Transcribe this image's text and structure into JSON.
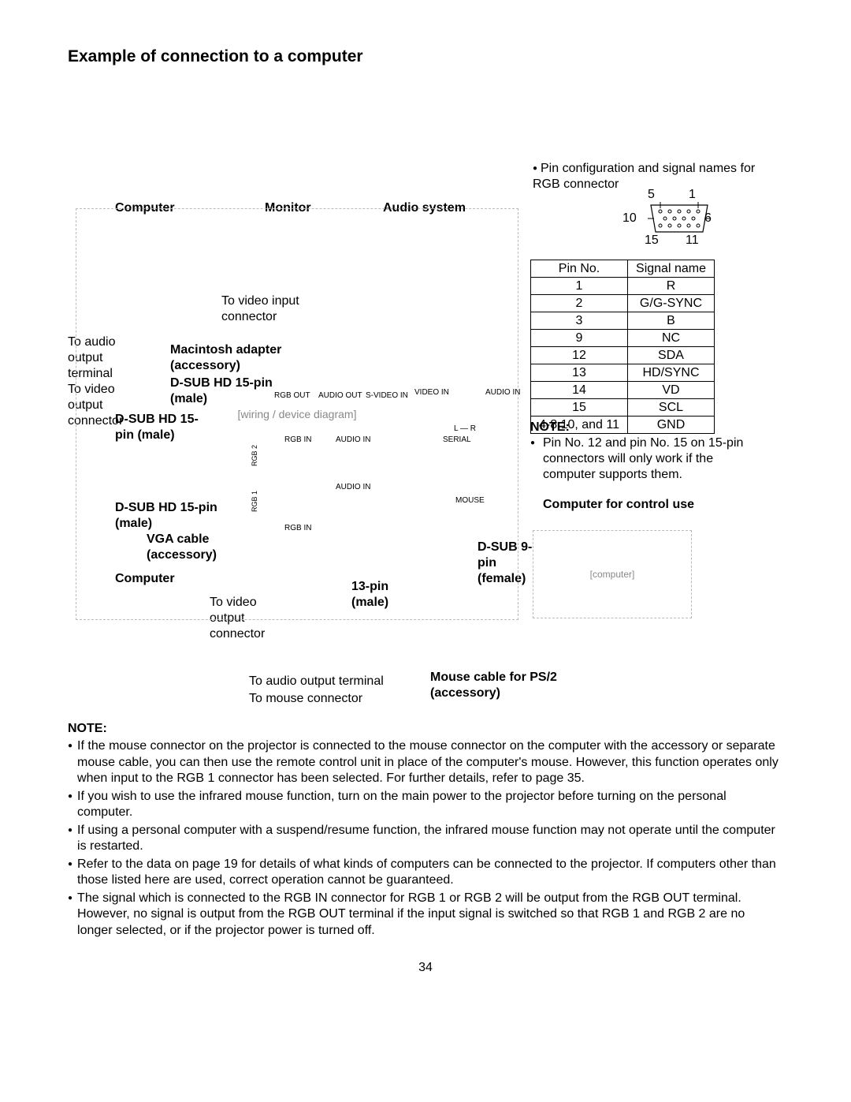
{
  "title": "Example of connection to a computer",
  "pin_header": "Pin configuration and signal names for RGB connector",
  "connector_numbers": {
    "tl": "5",
    "tr": "1",
    "ml": "10",
    "mr": "6",
    "bl": "15",
    "br": "11"
  },
  "labels": {
    "computer": "Computer",
    "monitor": "Monitor",
    "audio_system": "Audio system",
    "to_audio_output_terminal_left": "To audio output terminal",
    "to_video_output_connector_left": "To video output connector",
    "to_video_input_connector": "To video input connector",
    "mac_adapter": "Macintosh adapter (accessory)",
    "dsub_hd15_male_top": "D-SUB HD 15-pin (male)",
    "dsub_hd15_male_left": "D-SUB HD 15-pin (male)",
    "dsub_hd15_male_lower": "D-SUB HD 15-pin (male)",
    "vga_cable": "VGA cable (accessory)",
    "computer2": "Computer",
    "to_video_output_connector2": "To video output connector",
    "to_audio_output_terminal2": "To audio output terminal",
    "to_mouse_connector": "To mouse connector",
    "pin13_male": "13-pin (male)",
    "dsub9_female": "D-SUB 9-pin (female)",
    "mouse_cable": "Mouse cable for PS/2 (accessory)",
    "computer_control": "Computer for control use",
    "port_rgb_out": "RGB OUT",
    "port_audio_out": "AUDIO OUT",
    "port_svideo_in": "S-VIDEO IN",
    "port_video_in": "VIDEO IN",
    "port_audio_in_top": "AUDIO IN",
    "port_rgb_in": "RGB IN",
    "port_audio_in": "AUDIO IN",
    "port_serial": "SERIAL",
    "port_lr": "L — R",
    "port_rgb2": "RGB 2",
    "port_rgb1": "RGB 1",
    "port_mouse": "MOUSE"
  },
  "pin_table": {
    "headers": [
      "Pin No.",
      "Signal name"
    ],
    "rows": [
      [
        "1",
        "R"
      ],
      [
        "2",
        "G/G-SYNC"
      ],
      [
        "3",
        "B"
      ],
      [
        "9",
        "NC"
      ],
      [
        "12",
        "SDA"
      ],
      [
        "13",
        "HD/SYNC"
      ],
      [
        "14",
        "VD"
      ],
      [
        "15",
        "SCL"
      ],
      [
        "4-8,10, and 11",
        "GND"
      ]
    ]
  },
  "pin_note": {
    "head": "NOTE:",
    "text": "Pin No. 12 and pin No. 15 on 15-pin connectors will only work if the computer supports them."
  },
  "notes": {
    "head": "NOTE:",
    "items": [
      "If the mouse connector on the projector is connected to the mouse connector on the computer with the accessory or separate mouse cable, you can then use the remote control unit in place of the computer's mouse. However, this function operates only when input to the RGB 1 connector has been selected. For further details, refer to page 35.",
      "If you wish to use the infrared mouse function, turn on the main power to the projector before turning on the personal computer.",
      "If using a personal computer with a suspend/resume function, the infrared mouse function may not operate until the computer is restarted.",
      "Refer to the data on page 19 for details of what kinds of computers can be connected to the projector. If computers other than those listed here are used, correct operation cannot be guaranteed.",
      "The signal which is connected to the RGB IN connector for RGB 1 or RGB 2 will be output from the RGB OUT terminal. However, no signal is output from the RGB OUT terminal if the input signal is switched so that RGB 1 and RGB 2 are no longer selected, or if the projector power is turned off."
    ]
  },
  "page_number": "34"
}
